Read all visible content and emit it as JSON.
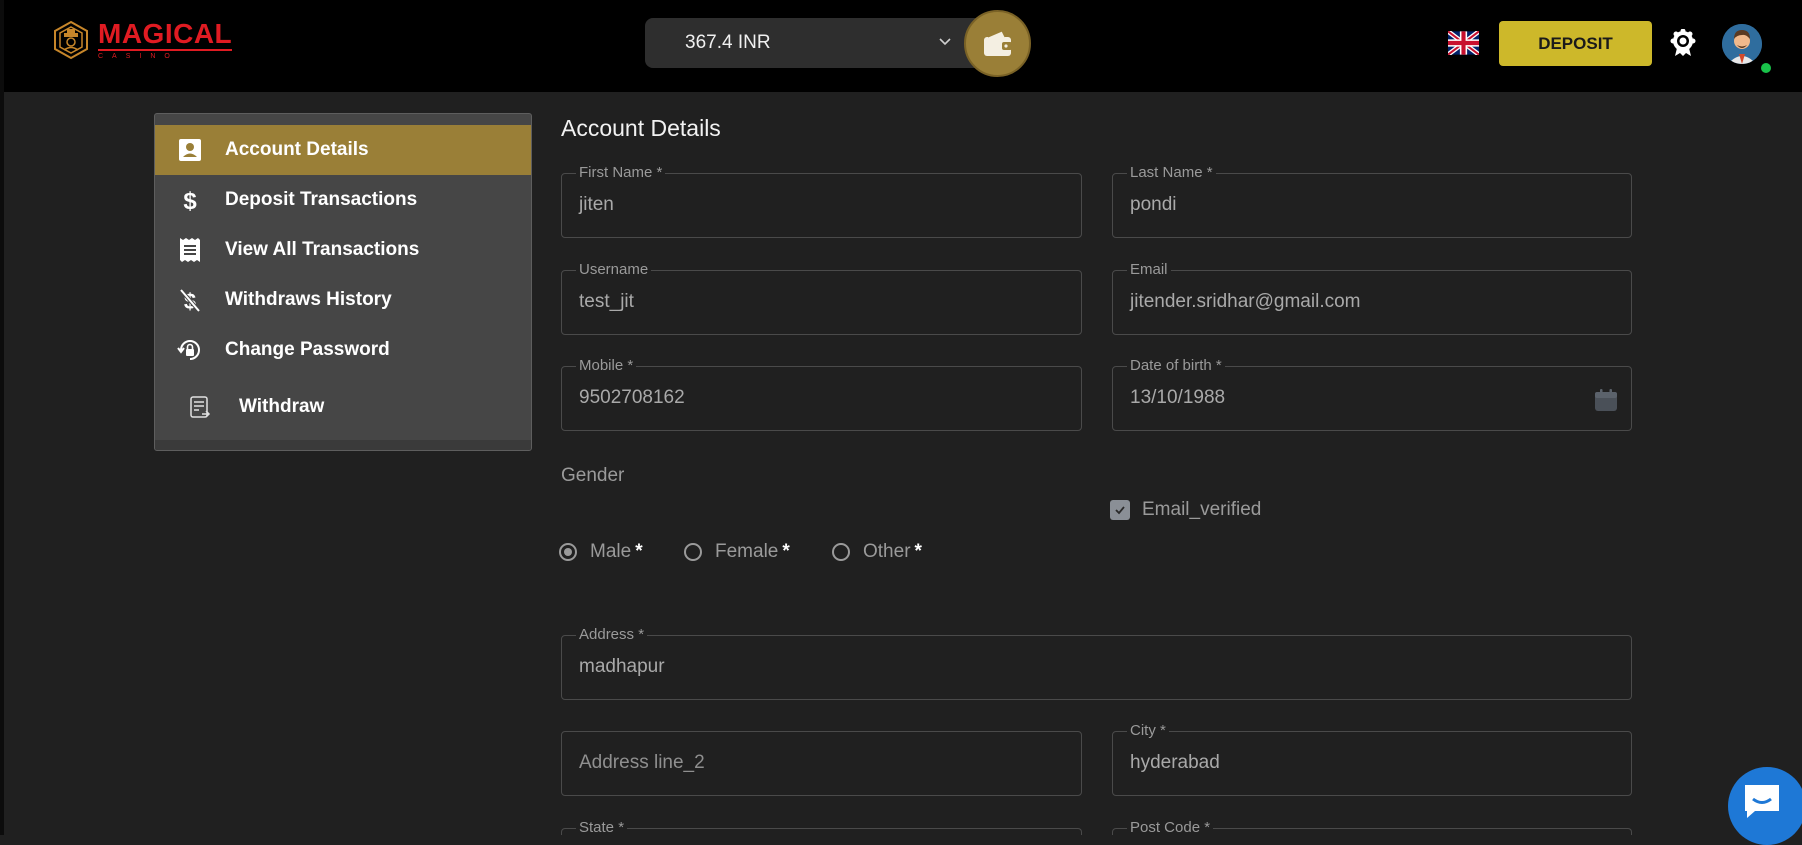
{
  "header": {
    "logo_main": "MAGICAL",
    "logo_sub": "CASINO",
    "balance": "367.4 INR",
    "deposit_label": "DEPOSIT"
  },
  "sidebar": {
    "items": [
      {
        "label": "Account Details",
        "icon": "account-box-icon",
        "active": true
      },
      {
        "label": "Deposit Transactions",
        "icon": "dollar-icon"
      },
      {
        "label": "View All Transactions",
        "icon": "receipt-icon"
      },
      {
        "label": "Withdraws History",
        "icon": "money-off-icon"
      },
      {
        "label": "Change Password",
        "icon": "lock-reset-icon"
      },
      {
        "label": "Withdraw",
        "icon": "withdraw-document-icon"
      }
    ]
  },
  "form": {
    "title": "Account Details",
    "first_name": {
      "label": "First Name *",
      "value": "jiten"
    },
    "last_name": {
      "label": "Last Name *",
      "value": "pondi"
    },
    "username": {
      "label": "Username",
      "value": "test_jit"
    },
    "email": {
      "label": "Email",
      "value": "jitender.sridhar@gmail.com"
    },
    "mobile": {
      "label": "Mobile *",
      "value": "9502708162"
    },
    "dob": {
      "label": "Date of birth *",
      "value": "13/10/1988"
    },
    "gender_label": "Gender",
    "gender_options": [
      {
        "label": "Male",
        "req": "*",
        "checked": true
      },
      {
        "label": "Female",
        "req": "*"
      },
      {
        "label": "Other",
        "req": "*"
      }
    ],
    "email_verified_label": "Email_verified",
    "address": {
      "label": "Address *",
      "value": "madhapur"
    },
    "address2": {
      "placeholder": "Address line_2"
    },
    "city": {
      "label": "City *",
      "value": "hyderabad"
    },
    "state": {
      "label": "State *"
    },
    "post_code": {
      "label": "Post Code *"
    }
  },
  "colors": {
    "accent_gold": "#9a7f37",
    "deposit_yellow": "#cdb82a",
    "logo_red": "#e01b22",
    "chat_blue": "#1e78d6",
    "online_green": "#19c24a"
  }
}
